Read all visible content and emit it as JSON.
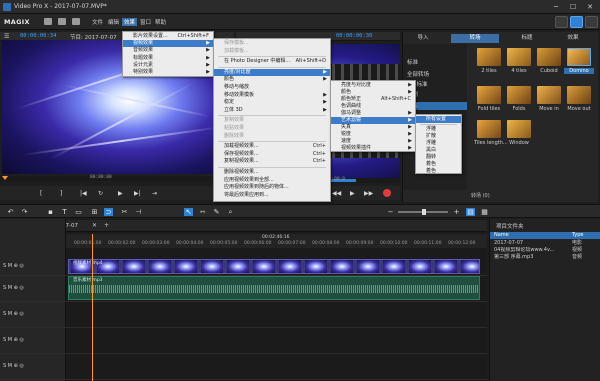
{
  "window": {
    "title": "Video Pro X - 2017-07-07.MVP*",
    "controls": [
      "─",
      "☐",
      "✕"
    ]
  },
  "menubar": {
    "logo": "MAGIX",
    "items": [
      "文件",
      "编辑",
      "效果",
      "窗口",
      "帮助"
    ],
    "active_index": 2
  },
  "source_monitor": {
    "timecode_left": "00:00:00:34",
    "node_label": "节目: 2017-07-07",
    "timecode_bottom": "00:00:00"
  },
  "program_monitor": {
    "timecode": "00:00:00:30",
    "timecode_bottom": "00:00:0"
  },
  "effects_panel": {
    "tabs": [
      "导入",
      "转场",
      "标题",
      "效果"
    ],
    "selected_tab": 1,
    "tree": [
      "标准",
      "全部转场",
      "3D 标准",
      "系列",
      "星形",
      "新的",
      "运动"
    ],
    "selected_tree_index": 4,
    "thumbs_row1": [
      "2 tiles",
      "4 tiles",
      "Cuboid",
      "Domino"
    ],
    "thumbs_row2": [
      "Fold tiles",
      "Folds",
      "Move in",
      "Move out"
    ],
    "thumbs_row3": [
      "Tiles length...",
      "Window"
    ],
    "footer": "转场 (0)"
  },
  "menu_effects": {
    "items": [
      {
        "label": "影片效果设置...",
        "shortcut": "Ctrl+Shift+F",
        "arrow": false,
        "disabled": false
      },
      {
        "label": "视频效果",
        "shortcut": "",
        "arrow": true,
        "disabled": false,
        "highlighted": true
      },
      {
        "label": "音频效果",
        "shortcut": "",
        "arrow": true,
        "disabled": false
      },
      {
        "label": "标题效果",
        "shortcut": "",
        "arrow": true,
        "disabled": false
      },
      {
        "label": "设计元素",
        "shortcut": "",
        "arrow": true,
        "disabled": false
      },
      {
        "label": "特别效果",
        "shortcut": "",
        "arrow": true,
        "disabled": false
      }
    ]
  },
  "menu_video": {
    "items": [
      {
        "label": "保存模板...",
        "disabled": true
      },
      {
        "label": "加载模板...",
        "disabled": true
      },
      {
        "label": "在 Photo Designer 中编辑...",
        "shortcut": "Alt+Shift+D",
        "disabled": false
      },
      {
        "label": "亮度/对比度",
        "arrow": true,
        "highlighted": true
      },
      {
        "label": "颜色",
        "arrow": true
      },
      {
        "label": "移动与缩放"
      },
      {
        "label": "移动效果模板",
        "arrow": true
      },
      {
        "label": "稳定",
        "arrow": true
      },
      {
        "label": "立体 3D",
        "arrow": true
      },
      {
        "label": "复制效果",
        "disabled": true
      },
      {
        "label": "粘贴效果",
        "disabled": true
      },
      {
        "label": "删除效果",
        "disabled": true
      },
      {
        "label": "加载视频效果...",
        "shortcut": "Ctrl+"
      },
      {
        "label": "保存视频效果...",
        "shortcut": "Ctrl+"
      },
      {
        "label": "复制视频效果...",
        "shortcut": "Ctrl+"
      },
      {
        "label": "删除视频效果..."
      },
      {
        "label": "应用视频效果到全部..."
      },
      {
        "label": "应用视频效果到随后的物体..."
      },
      {
        "label": "将最后效果应用到..."
      }
    ]
  },
  "menu_brightness": {
    "items": [
      {
        "label": "亮度与对比度",
        "arrow": true
      },
      {
        "label": "颜色",
        "arrow": true
      },
      {
        "label": "颜色矫正",
        "shortcut": "Alt+Shift+C"
      },
      {
        "label": "色调曲线"
      },
      {
        "label": "伽马调整",
        "arrow": true
      },
      {
        "label": "艺术滤镜",
        "arrow": true,
        "highlighted": true
      },
      {
        "label": "失真",
        "arrow": true
      },
      {
        "label": "锐度",
        "arrow": true
      },
      {
        "label": "速度",
        "arrow": true
      },
      {
        "label": "视频效果插件",
        "arrow": true
      }
    ]
  },
  "menu_art": {
    "items": [
      {
        "label": "所有设置",
        "highlighted": true
      },
      {
        "label": "浮雕"
      },
      {
        "label": "扩散"
      },
      {
        "label": "浮雕"
      },
      {
        "label": "黑白"
      },
      {
        "label": "翻转"
      },
      {
        "label": "着色"
      },
      {
        "label": "着色"
      }
    ]
  },
  "timeline": {
    "tab_label": "2017-07-07",
    "ruler_center": "00:02:46:16",
    "ruler_ticks": [
      "00:00:01:00",
      "00:00:02:00",
      "00:00:03:00",
      "00:00:04:00",
      "00:00:05:00",
      "00:00:06:00",
      "00:00:07:00",
      "00:00:08:00",
      "00:00:09:00",
      "00:00:10:00",
      "00:00:11:00",
      "00:00:12:00"
    ],
    "tracks": [
      {
        "num": "1",
        "label": "S M ⊕ ◎"
      },
      {
        "num": "2",
        "label": "S M ⊕ ◎"
      },
      {
        "num": "3",
        "label": "S M ⊕ ◎"
      },
      {
        "num": "4",
        "label": "S M ⊕ ◎"
      },
      {
        "num": "5",
        "label": "S M ⊕ ◎"
      }
    ],
    "clip_label": "视频素材 mp4",
    "audio_label": "音乐素材 mp3"
  },
  "project_panel": {
    "title": "项目文件夹",
    "columns": [
      "Name",
      "Type"
    ],
    "rows": [
      {
        "name": "2017-07-07",
        "type": "电影"
      },
      {
        "name": "04视频剪辑论坛www.4v...",
        "type": "视频"
      },
      {
        "name": "第三部 序幕.mp3",
        "type": "音频"
      }
    ]
  },
  "colors": {
    "accent": "#2f83d6",
    "timecode": "#3aa1ff",
    "playhead": "#ff9a1e",
    "menu_highlight": "#3d7cc9"
  }
}
